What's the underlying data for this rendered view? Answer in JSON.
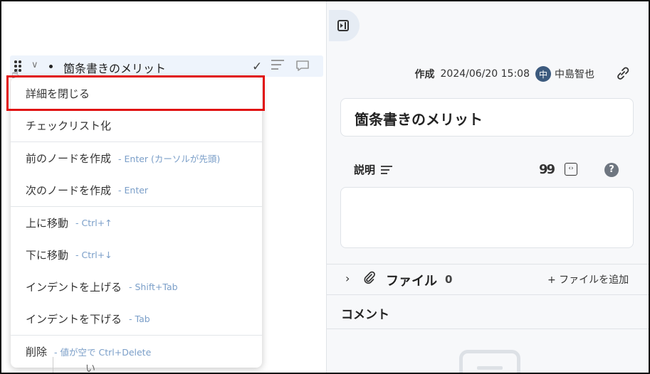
{
  "outline": {
    "node_title": "箇条書きのメリット",
    "tail_text": "い"
  },
  "context_menu": {
    "items": [
      {
        "label": "詳細を閉じる",
        "hint": ""
      },
      {
        "label": "チェックリスト化",
        "hint": ""
      },
      {
        "label": "前のノードを作成",
        "hint": "- Enter (カーソルが先頭)"
      },
      {
        "label": "次のノードを作成",
        "hint": "- Enter"
      },
      {
        "label": "上に移動",
        "hint": "- Ctrl+↑"
      },
      {
        "label": "下に移動",
        "hint": "- Ctrl+↓"
      },
      {
        "label": "インデントを上げる",
        "hint": "- Shift+Tab"
      },
      {
        "label": "インデントを下げる",
        "hint": "- Tab"
      },
      {
        "label": "削除",
        "hint": "- 値が空で Ctrl+Delete"
      }
    ],
    "highlighted_item": "詳細を閉じる"
  },
  "detail": {
    "created_label": "作成",
    "created_at": "2024/06/20 15:08",
    "avatar_initial": "中",
    "author": "中島智也",
    "title": "箇条書きのメリット",
    "description_label": "説明",
    "quote_icon_text": "99",
    "code_icon_text": "‹›",
    "help_icon_text": "?",
    "files_label": "ファイル",
    "files_count": "0",
    "add_file_label": "+ ファイルを追加",
    "comments_label": "コメント"
  },
  "colors": {
    "highlight_border": "#e11212",
    "hint_text": "#7a9ec8",
    "avatar_bg": "#3c5a7e",
    "selected_row_bg": "#eef4fc"
  },
  "icons": [
    "drag-handle-icon",
    "chevron-down-icon",
    "check-icon",
    "description-icon",
    "comment-icon",
    "pointer-hand-icon",
    "panel-toggle-icon",
    "link-icon",
    "quote-icon",
    "code-icon",
    "help-icon",
    "chevron-right-icon",
    "paperclip-icon",
    "plus-icon",
    "empty-comment-icon"
  ]
}
